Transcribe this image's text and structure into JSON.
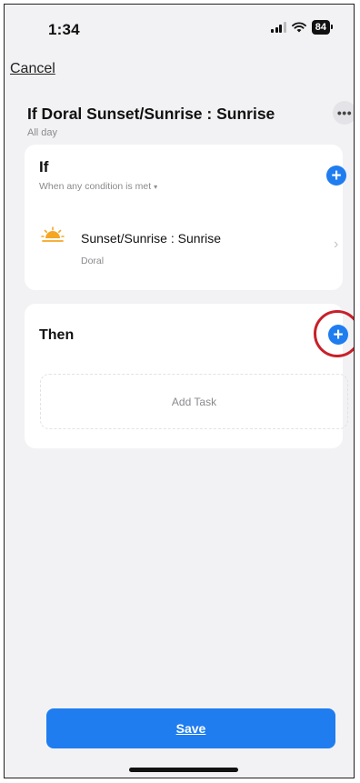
{
  "status_bar": {
    "time": "1:34",
    "battery": "84"
  },
  "header": {
    "cancel_label": "Cancel",
    "title": "If Doral Sunset/Sunrise : Sunrise",
    "subtitle": "All day",
    "more_icon": "more-horizontal-icon",
    "more_glyph": "•••"
  },
  "if_section": {
    "label": "If",
    "condition_mode": "When any condition is met",
    "add_icon": "plus-icon",
    "conditions": [
      {
        "title": "Sunset/Sunrise : Sunrise",
        "subtitle": "Doral",
        "icon": "sunrise-icon"
      }
    ]
  },
  "then_section": {
    "label": "Then",
    "add_icon": "plus-icon",
    "add_task_label": "Add Task"
  },
  "footer": {
    "save_label": "Save"
  },
  "colors": {
    "accent": "#1f7df0",
    "highlight_ring": "#c8202a",
    "sun_icon": "#f5a623",
    "background": "#f2f2f4"
  }
}
